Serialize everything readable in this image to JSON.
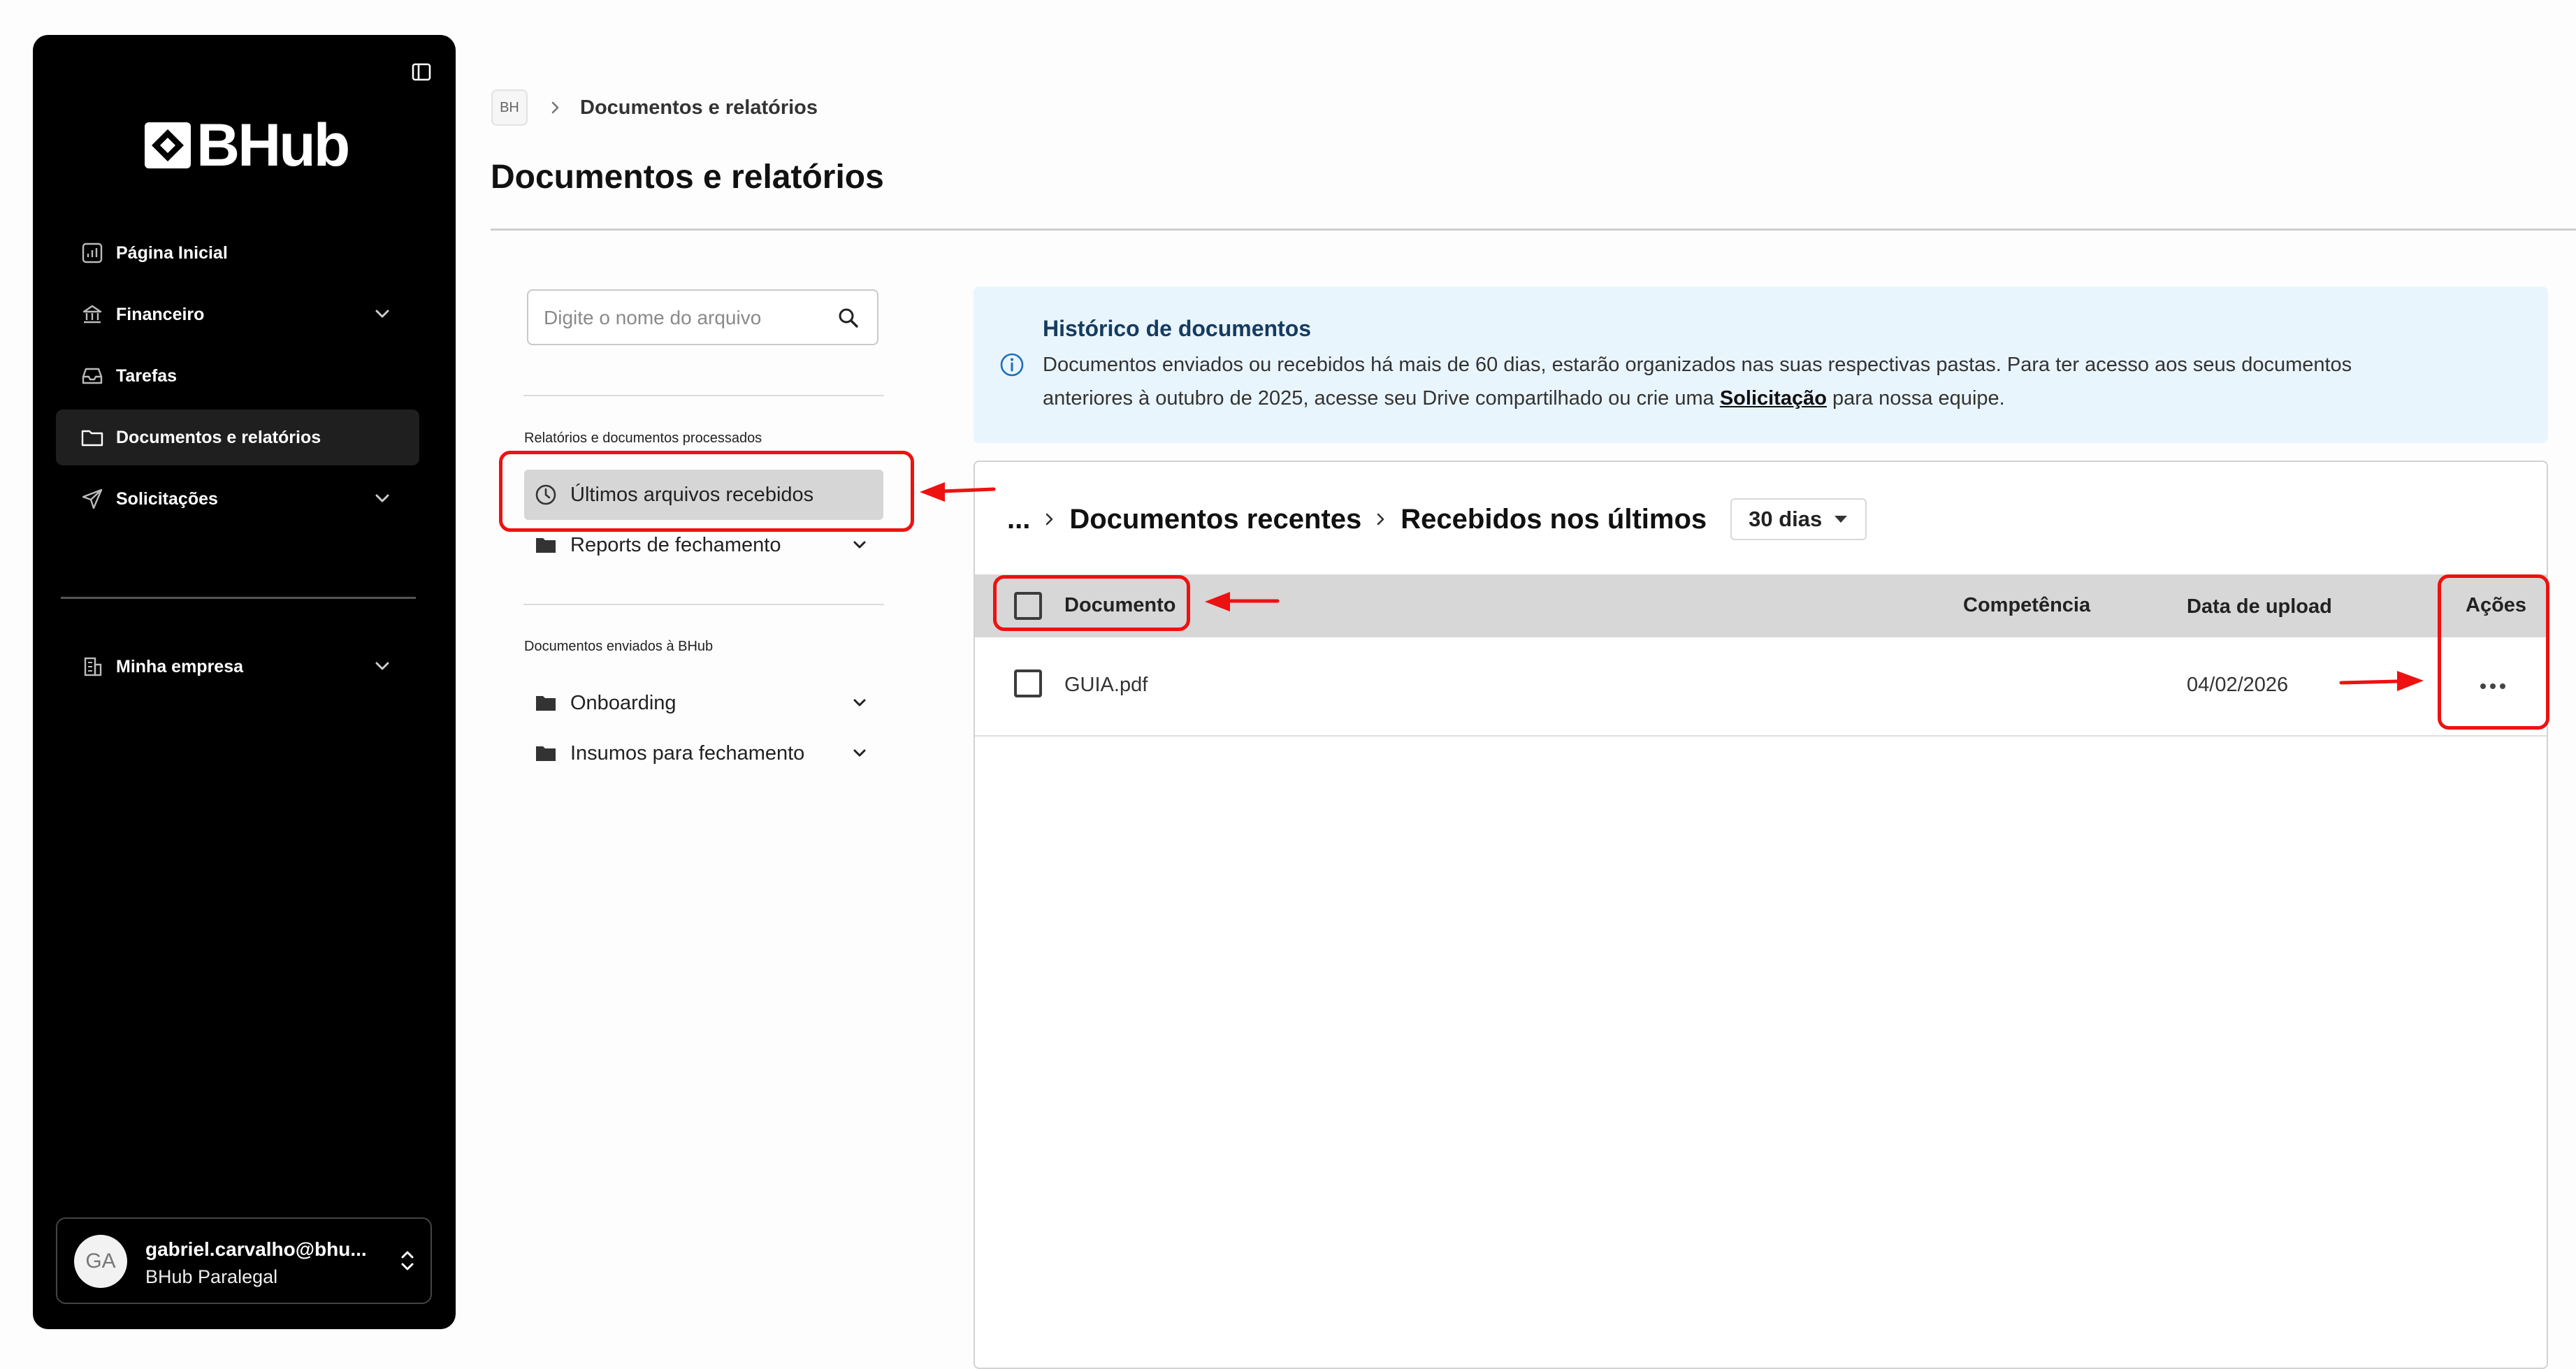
{
  "sidebar": {
    "logo_text": "BHub",
    "items": [
      {
        "label": "Página Inicial",
        "icon": "chart-icon",
        "active": false
      },
      {
        "label": "Financeiro",
        "icon": "bank-icon",
        "active": false,
        "expandable": true
      },
      {
        "label": "Tarefas",
        "icon": "inbox-icon",
        "active": false
      },
      {
        "label": "Documentos e relatórios",
        "icon": "folder-icon",
        "active": true
      },
      {
        "label": "Solicitações",
        "icon": "send-icon",
        "active": false,
        "expandable": true
      }
    ],
    "secondary_items": [
      {
        "label": "Minha empresa",
        "icon": "building-icon",
        "expandable": true
      }
    ],
    "user": {
      "initials": "GA",
      "name": "gabriel.carvalho@bhu...",
      "company": "BHub Paralegal"
    }
  },
  "header": {
    "breadcrumb_badge": "BH",
    "breadcrumb_current": "Documentos e relatórios",
    "title": "Documentos e relatórios"
  },
  "left_panel": {
    "search_placeholder": "Digite o nome do arquivo",
    "section1_label": "Relatórios e documentos processados",
    "section1_items": [
      {
        "label": "Últimos arquivos recebidos",
        "icon": "clock-icon",
        "selected": true
      },
      {
        "label": "Reports de fechamento",
        "icon": "folder-icon",
        "expandable": true
      }
    ],
    "section2_label": "Documentos enviados à BHub",
    "section2_items": [
      {
        "label": "Onboarding",
        "icon": "folder-icon",
        "expandable": true
      },
      {
        "label": "Insumos para fechamento",
        "icon": "folder-icon",
        "expandable": true
      }
    ]
  },
  "info_banner": {
    "title": "Histórico de documentos",
    "text_line1": "Documentos enviados ou recebidos há mais de 60 dias, estarão organizados nas suas respectivas pastas. Para ter acesso aos seus documentos",
    "text_line2_before": "anteriores à outubro de 2025, acesse seu Drive compartilhado ou crie uma ",
    "link": "Solicitação",
    "text_line2_after": " para nossa equipe."
  },
  "documents": {
    "path": {
      "ellipsis": "...",
      "crumb1": "Documentos recentes",
      "crumb2": "Recebidos nos últimos",
      "days_selected": "30 dias"
    },
    "columns": {
      "document": "Documento",
      "competencia": "Competência",
      "upload_date": "Data de upload",
      "actions": "Ações"
    },
    "rows": [
      {
        "name": "GUIA.pdf",
        "competencia": "",
        "upload_date": "04/02/2026",
        "actions": "•••"
      }
    ]
  },
  "colors": {
    "sidebar_bg": "#000000",
    "annotation_red": "#ee1111",
    "banner_bg": "#e9f5fd",
    "banner_title": "#163b60",
    "table_header_bg": "#d7d7d7"
  }
}
